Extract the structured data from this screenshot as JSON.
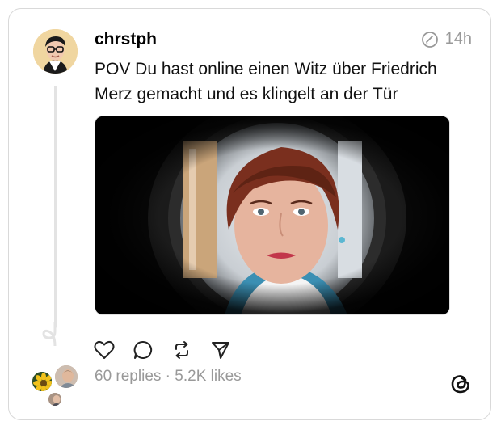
{
  "post": {
    "username": "chrstph",
    "timestamp": "14h",
    "text_line1": "POV Du hast online einen Witz über Friedrich",
    "text_line2": "Merz gemacht und es klingelt an der Tür"
  },
  "actions": {
    "like": "heart-icon",
    "reply": "comment-icon",
    "repost": "repost-icon",
    "share": "send-icon"
  },
  "stats": {
    "replies": "60 replies",
    "separator": "·",
    "likes": "5.2K likes"
  },
  "icons": {
    "timestamp": "edited-clock-icon",
    "brand": "threads-logo-icon"
  },
  "colors": {
    "muted": "#999999",
    "border": "#d9d9d9",
    "thread_line": "#e3e3e3"
  }
}
